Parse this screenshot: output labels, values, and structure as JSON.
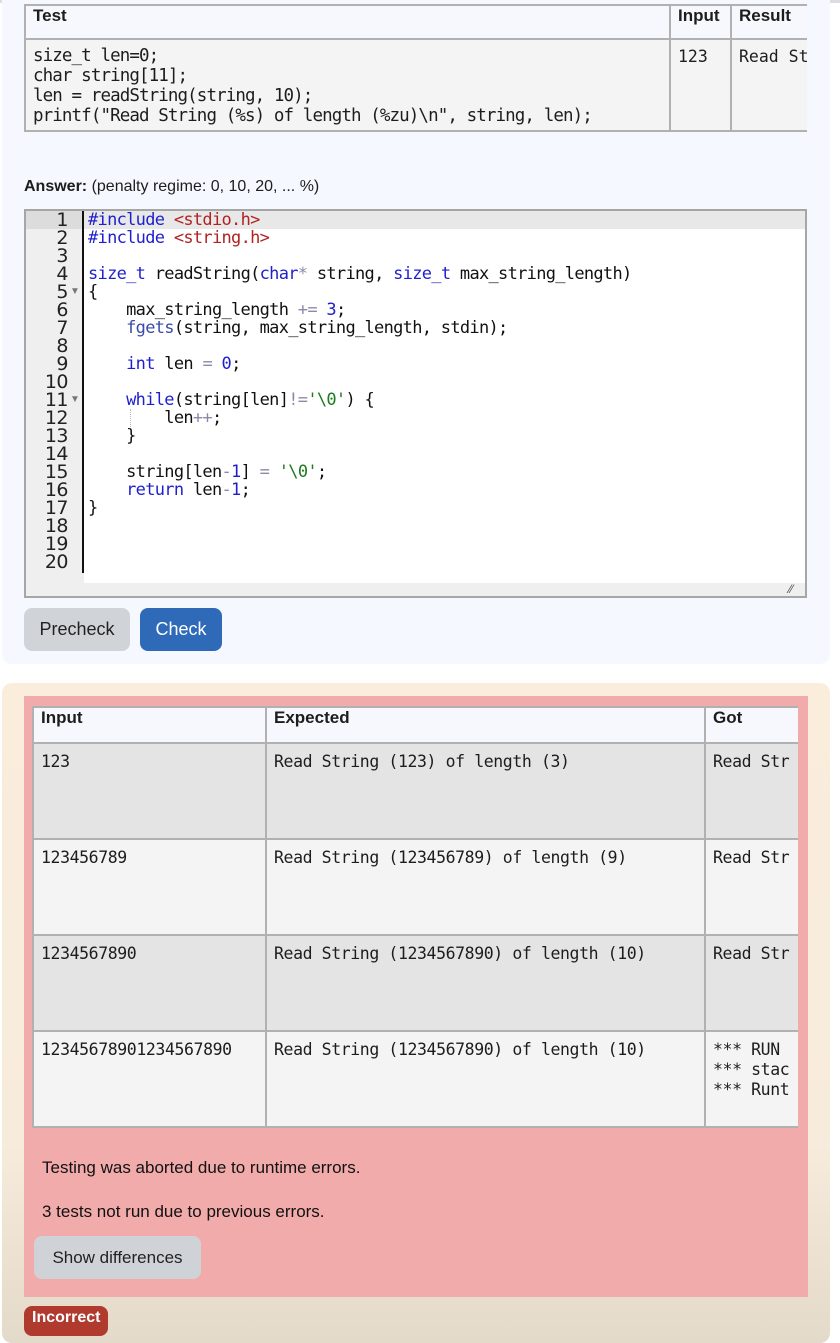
{
  "test_table": {
    "headers": [
      "Test",
      "Input",
      "Result"
    ],
    "rows": [
      {
        "test": "size_t len=0;\nchar string[11];\nlen = readString(string, 10);\nprintf(\"Read String (%s) of length (%zu)\\n\", string, len);",
        "input": "123",
        "result": "Read St"
      }
    ]
  },
  "answer": {
    "label": "Answer:",
    "penalty": "(penalty regime: 0, 10, 20, ... %)"
  },
  "editor": {
    "line_numbers": [
      "1",
      "2",
      "3",
      "4",
      "5",
      "6",
      "7",
      "8",
      "9",
      "10",
      "11",
      "12",
      "13",
      "14",
      "15",
      "16",
      "17",
      "18",
      "19",
      "20"
    ],
    "fold_markers": [
      "5",
      "11"
    ],
    "code": {
      "l1_kw": "#include",
      "l1_hdr": "<stdio.h>",
      "l2_kw": "#include",
      "l2_hdr": "<string.h>",
      "l4_type": "size_t",
      "l4_name": " readString(",
      "l4_type2": "char",
      "l4_star": "*",
      "l4_rest": " string, ",
      "l4_type3": "size_t",
      "l4_end": " max_string_length)",
      "l5": "{",
      "l6_a": "    max_string_length ",
      "l6_op": "+=",
      "l6_sp": " ",
      "l6_num": "3",
      "l6_end": ";",
      "l7_fn": "    fgets",
      "l7_rest": "(string, max_string_length, stdin);",
      "l9_kw": "    int",
      "l9_a": " len ",
      "l9_op": "=",
      "l9_sp": " ",
      "l9_num": "0",
      "l9_end": ";",
      "l11_kw": "    while",
      "l11_a": "(string[len]",
      "l11_op": "!=",
      "l11_str": "'\\0'",
      "l11_end": ") {",
      "l12_a": "        len",
      "l12_op": "++",
      "l12_end": ";",
      "l13": "    }",
      "l15_a": "    string[len",
      "l15_op": "-",
      "l15_num": "1",
      "l15_b": "] ",
      "l15_op2": "=",
      "l15_sp": " ",
      "l15_str": "'\\0'",
      "l15_end": ";",
      "l16_kw": "    return",
      "l16_a": " len",
      "l16_op": "-",
      "l16_num": "1",
      "l16_end": ";",
      "l17": "}"
    }
  },
  "buttons": {
    "precheck": "Precheck",
    "check": "Check",
    "show_differences": "Show differences"
  },
  "results": {
    "headers": [
      "Input",
      "Expected",
      "Got"
    ],
    "rows": [
      {
        "input": "123",
        "expected": "Read String (123) of length (3)",
        "got": "Read Str"
      },
      {
        "input": "123456789",
        "expected": "Read String (123456789) of length (9)",
        "got": "Read Str"
      },
      {
        "input": "1234567890",
        "expected": "Read String (1234567890) of length (10)",
        "got": "Read Str"
      },
      {
        "input": "12345678901234567890",
        "expected": "Read String (1234567890) of length (10)",
        "got": "*** RUN\n*** stac\n*** Runt"
      }
    ],
    "abort_message": "Testing was aborted due to runtime errors.",
    "not_run_message": "3 tests not run due to previous errors."
  },
  "status_badge": "Incorrect",
  "colors": {
    "check_button": "#2e6ab8",
    "result_fail_bg": "#f2abab",
    "incorrect_badge": "#b13a2e"
  }
}
